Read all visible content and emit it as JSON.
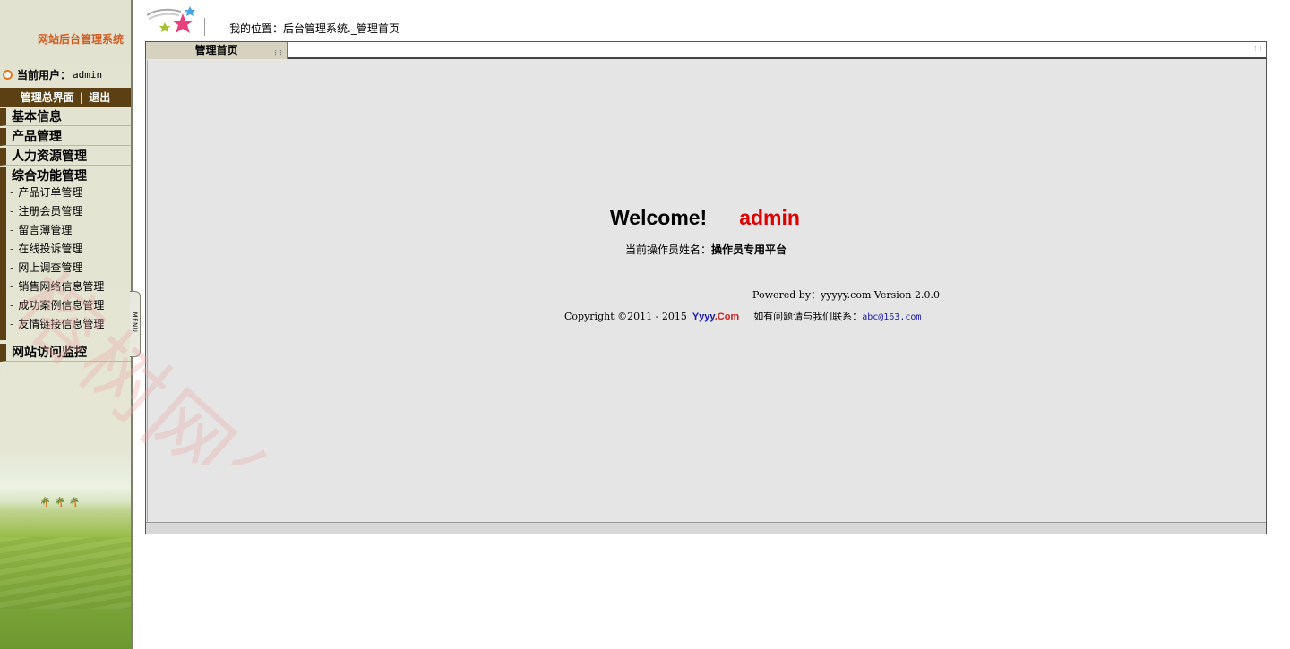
{
  "sidebar": {
    "system_title": "网站后台管理系统",
    "current_user_label": "当前用户：",
    "current_user_value": "admin",
    "topbar": {
      "home": "管理总界面",
      "separator": "|",
      "logout": "退出"
    },
    "sections": [
      {
        "label": "基本信息"
      },
      {
        "label": "产品管理"
      },
      {
        "label": "人力资源管理"
      },
      {
        "label": "综合功能管理"
      }
    ],
    "sub_items": [
      {
        "label": "产品订单管理"
      },
      {
        "label": "注册会员管理"
      },
      {
        "label": "留言薄管理"
      },
      {
        "label": "在线投诉管理"
      },
      {
        "label": "网上调查管理"
      },
      {
        "label": "销售网络信息管理"
      },
      {
        "label": "成功案例信息管理"
      },
      {
        "label": "友情链接信息管理"
      }
    ],
    "monitor_section": {
      "label": "网站访问监控"
    },
    "menu_toggle": "MENU"
  },
  "header": {
    "location": "我的位置：后台管理系统._管理首页"
  },
  "panel": {
    "tab_label": "管理首页",
    "welcome_text": "Welcome!",
    "welcome_name": "admin",
    "operator_label": "当前操作员姓名：",
    "operator_value": "操作员专用平台",
    "powered_by": "Powered by：yyyyy.com Version 2.0.0",
    "copyright": "Copyright ©2011 - 2015",
    "brand_main": "Yyyy",
    "brand_suffix": ".Com",
    "contact_label": "如有问题请与我们联系：",
    "contact_email": "abc@163.com"
  },
  "watermark": "榕树网络",
  "colors": {
    "sidebar_dark": "#5a4012",
    "title_orange": "#d05a20",
    "welcome_red": "#e00000",
    "link_blue": "#1a1aa8",
    "panel_bg": "#e5e5e5"
  }
}
